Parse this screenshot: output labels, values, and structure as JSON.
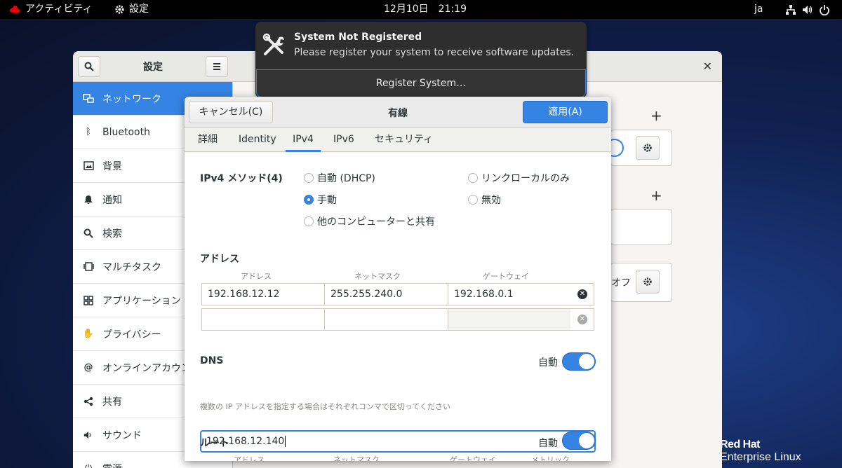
{
  "topbar": {
    "activities": "アクティビティ",
    "app_menu": "設定",
    "clock": "12月10日　21:19",
    "lang": "ja"
  },
  "brand": {
    "line1": "Red Hat",
    "line2": "Enterprise Linux"
  },
  "settings": {
    "title": "設定",
    "sidebar": [
      {
        "label": "ネットワーク",
        "icon": "network-icon"
      },
      {
        "label": "Bluetooth",
        "icon": "bluetooth-icon"
      },
      {
        "label": "背景",
        "icon": "background-icon"
      },
      {
        "label": "通知",
        "icon": "bell-icon"
      },
      {
        "label": "検索",
        "icon": "search-icon"
      },
      {
        "label": "マルチタスク",
        "icon": "multitask-icon"
      },
      {
        "label": "アプリケーション",
        "icon": "apps-icon"
      },
      {
        "label": "プライバシー",
        "icon": "hand-icon"
      },
      {
        "label": "オンラインアカウント",
        "icon": "at-icon"
      },
      {
        "label": "共有",
        "icon": "share-icon"
      },
      {
        "label": "サウンド",
        "icon": "speaker-icon"
      },
      {
        "label": "電源",
        "icon": "power-icon"
      }
    ],
    "bg_text_off": "オフ"
  },
  "notification": {
    "title": "System Not Registered",
    "body": "Please register your system to receive software updates.",
    "button": "Register System…"
  },
  "dialog": {
    "cancel": "キャンセル(C)",
    "title": "有線",
    "apply": "適用(A)",
    "tabs": [
      "詳細",
      "Identity",
      "IPv4",
      "IPv6",
      "セキュリティ"
    ],
    "active_tab": "IPv4",
    "method_label": "IPv4 メソッド(4)",
    "methods": {
      "dhcp": "自動 (DHCP)",
      "link_local": "リンクローカルのみ",
      "manual": "手動",
      "disabled": "無効",
      "shared": "他のコンピューターと共有"
    },
    "selected_method": "手動",
    "address_section": "アドレス",
    "address_columns": [
      "アドレス",
      "ネットマスク",
      "ゲートウェイ"
    ],
    "addresses": [
      [
        "192.168.12.12",
        "255.255.240.0",
        "192.168.0.1"
      ],
      [
        "",
        "",
        ""
      ]
    ],
    "dns_label": "DNS",
    "auto_label": "自動",
    "dns_value": "192.168.12.140",
    "dns_hint": "複数の IP アドレスを指定する場合はそれぞれコンマで区切ってください",
    "route_label": "ルート",
    "route_columns": [
      "アドレス",
      "ネットマスク",
      "ゲートウェイ",
      "メトリック"
    ]
  }
}
